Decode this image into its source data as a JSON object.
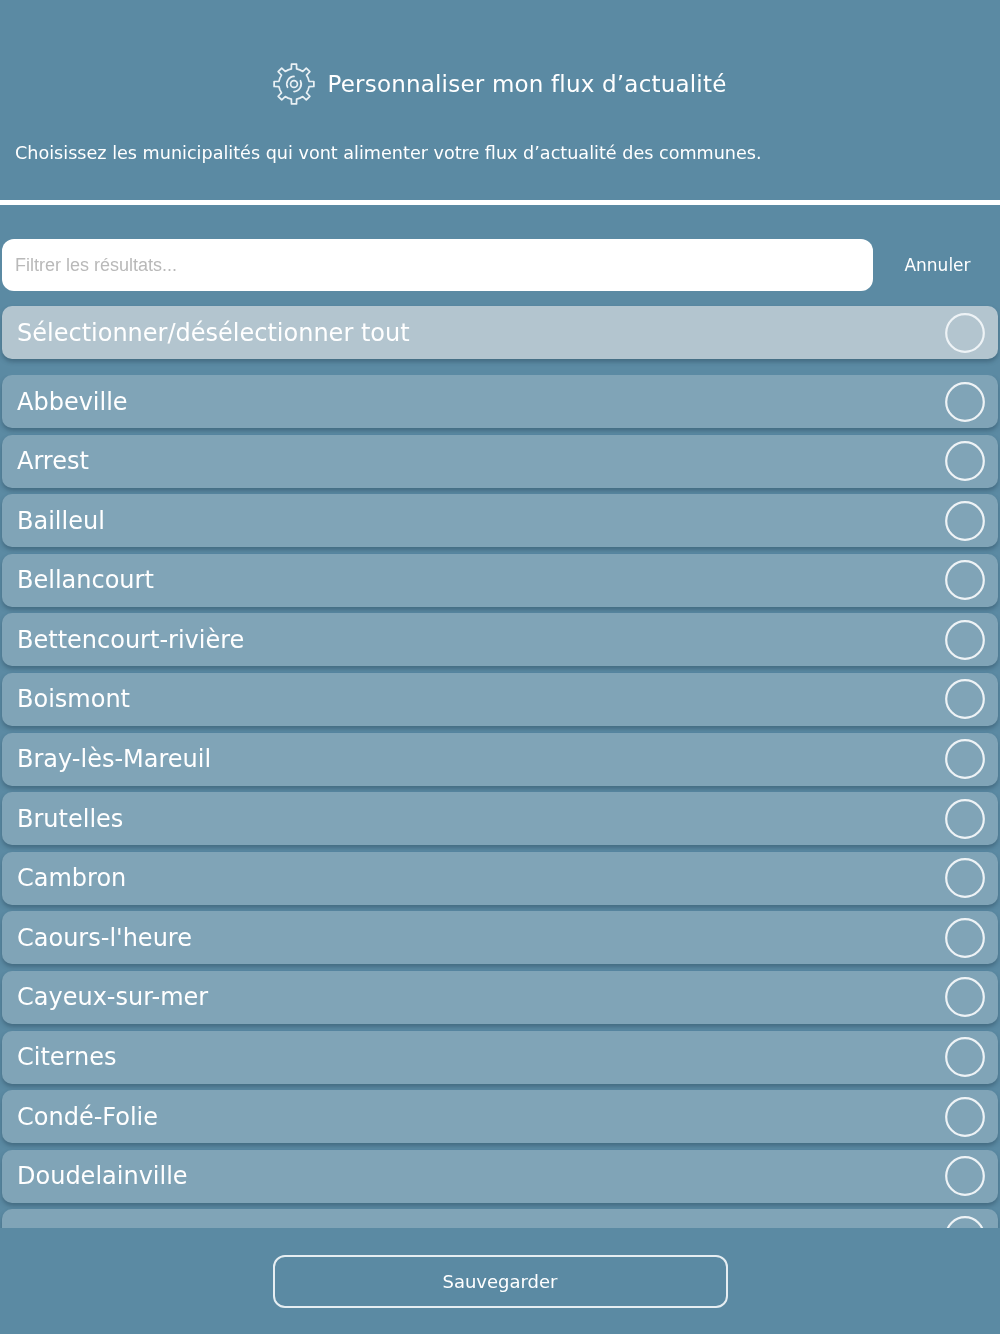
{
  "header": {
    "title": "Personnaliser mon flux d’actualité",
    "subtitle": "Choisissez les municipalités qui vont alimenter votre flux d’actualité des communes."
  },
  "search": {
    "placeholder": "Filtrer les résultats...",
    "cancel": "Annuler"
  },
  "select_all": {
    "label": "Sélectionner/désélectionner tout",
    "selected": false
  },
  "municipalities": [
    {
      "name": "Abbeville",
      "selected": false
    },
    {
      "name": "Arrest",
      "selected": false
    },
    {
      "name": "Bailleul",
      "selected": false
    },
    {
      "name": "Bellancourt",
      "selected": false
    },
    {
      "name": "Bettencourt-rivière",
      "selected": false
    },
    {
      "name": "Boismont",
      "selected": false
    },
    {
      "name": "Bray-lès-Mareuil",
      "selected": false
    },
    {
      "name": "Brutelles",
      "selected": false
    },
    {
      "name": "Cambron",
      "selected": false
    },
    {
      "name": "Caours-l'heure",
      "selected": false
    },
    {
      "name": "Cayeux-sur-mer",
      "selected": false
    },
    {
      "name": "Citernes",
      "selected": false
    },
    {
      "name": "Condé-Folie",
      "selected": false
    },
    {
      "name": "Doudelainville",
      "selected": false
    }
  ],
  "partial_row": {
    "selected": false
  },
  "footer": {
    "save_button": "Sauvegarder"
  }
}
